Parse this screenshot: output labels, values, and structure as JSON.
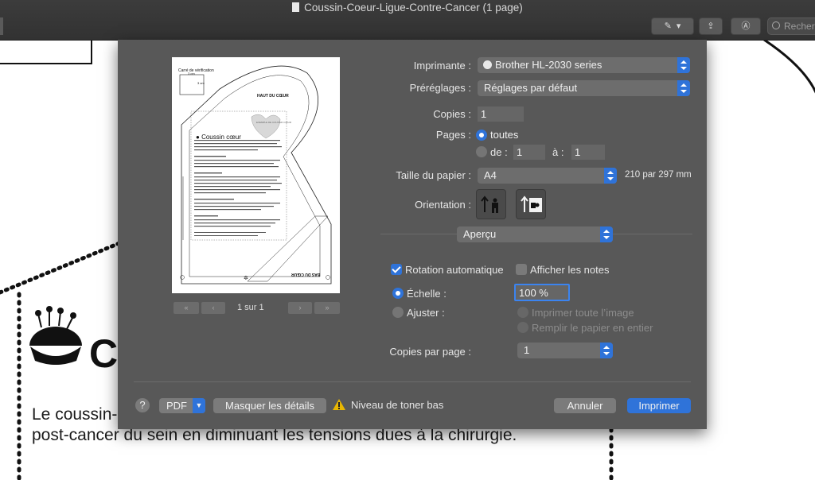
{
  "window": {
    "title": "Coussin-Coeur-Ligue-Contre-Cancer (1 page)",
    "search_placeholder": "Recherc"
  },
  "background_doc": {
    "heading_fragment": "C",
    "line1": "Le coussin-",
    "line2": "post-cancer du sein en diminuant les tensions dues à la chirurgie."
  },
  "preview": {
    "card_title": "Carré de vérification",
    "card_3cm_top": "3 cm",
    "card_3cm_side": "3 cm",
    "top_label": "HAUT DU CŒUR",
    "bottom_label": "BAS DU CŒUR",
    "title": "Coussin cœur",
    "heart_text": "EXEMPLE DE COUSSIN CŒUR",
    "page_indicator": "1 sur 1"
  },
  "print": {
    "printer_label": "Imprimante :",
    "printer_value": "Brother HL-2030 series",
    "presets_label": "Préréglages :",
    "presets_value": "Réglages par défaut",
    "copies_label": "Copies :",
    "copies_value": "1",
    "pages_label": "Pages :",
    "pages_all": "toutes",
    "pages_from_label": "de :",
    "pages_from_value": "1",
    "pages_to_label": "à :",
    "pages_to_value": "1",
    "paper_label": "Taille du papier :",
    "paper_value": "A4",
    "paper_dims": "210 par 297 mm",
    "orientation_label": "Orientation :",
    "section_value": "Aperçu",
    "auto_rotate_label": "Rotation automatique",
    "auto_rotate_checked": true,
    "show_notes_label": "Afficher les notes",
    "show_notes_checked": false,
    "scale_label": "Échelle :",
    "scale_value": "100 %",
    "fit_label": "Ajuster :",
    "fit_whole_image": "Imprimer toute l’image",
    "fit_fill_paper": "Remplir le papier en entier",
    "copies_per_page_label": "Copies par page :",
    "copies_per_page_value": "1"
  },
  "footer": {
    "help": "?",
    "pdf": "PDF",
    "hide_details": "Masquer les détails",
    "toner_warning": "Niveau de toner bas",
    "cancel": "Annuler",
    "print": "Imprimer"
  },
  "colors": {
    "accent": "#2f73d9",
    "sheet_bg": "#585858",
    "titlebar_bg": "#383838",
    "warning": "#e8b600"
  }
}
